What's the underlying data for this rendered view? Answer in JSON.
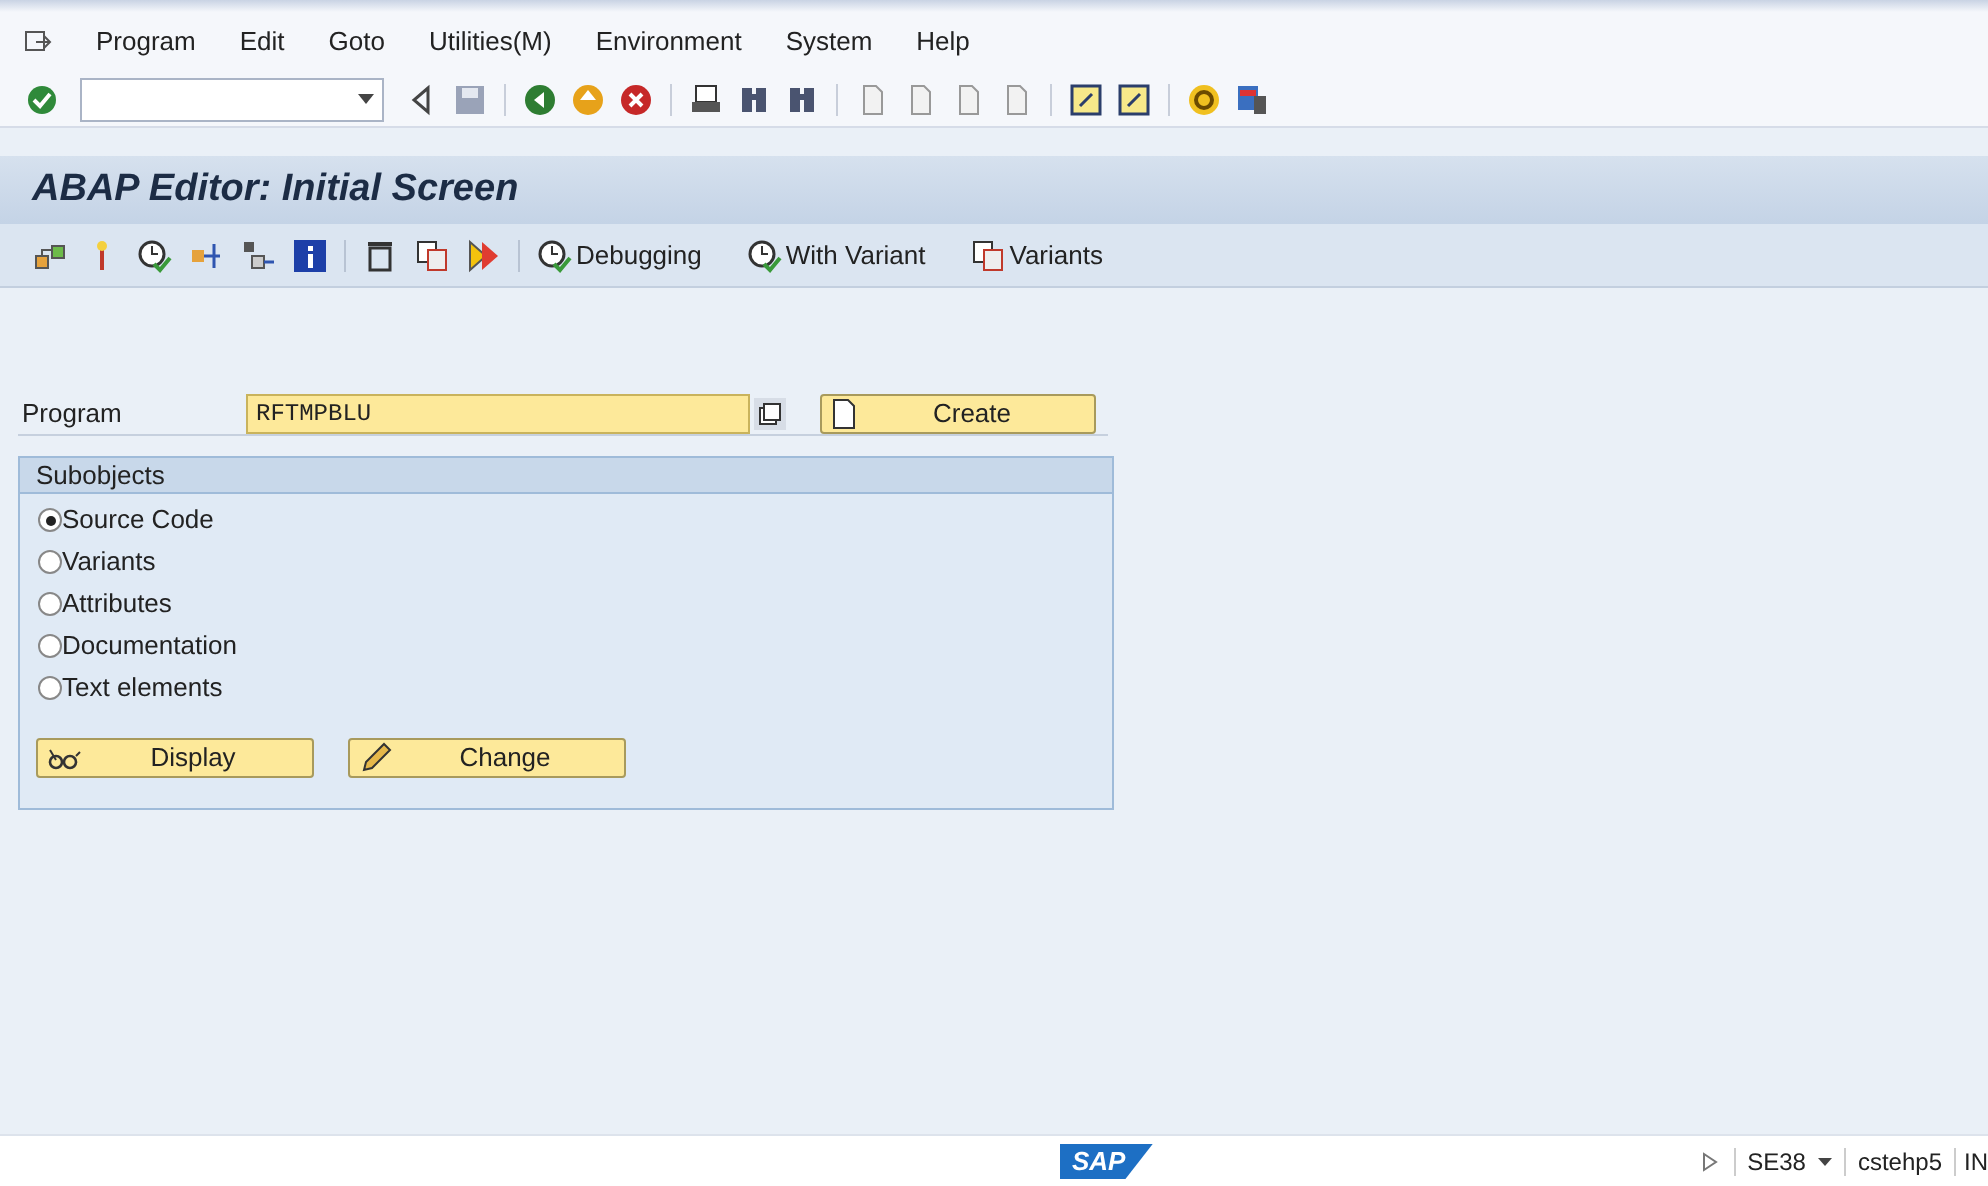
{
  "menu": [
    "Program",
    "Edit",
    "Goto",
    "Utilities(M)",
    "Environment",
    "System",
    "Help"
  ],
  "toolbar": [
    {
      "kind": "check"
    },
    {
      "kind": "field"
    },
    {
      "kind": "back"
    },
    {
      "kind": "save"
    },
    {
      "kind": "sep"
    },
    {
      "kind": "green"
    },
    {
      "kind": "orange"
    },
    {
      "kind": "red"
    },
    {
      "kind": "sep"
    },
    {
      "kind": "print"
    },
    {
      "kind": "find"
    },
    {
      "kind": "find"
    },
    {
      "kind": "sep"
    },
    {
      "kind": "page"
    },
    {
      "kind": "page"
    },
    {
      "kind": "page"
    },
    {
      "kind": "page"
    },
    {
      "kind": "sep"
    },
    {
      "kind": "window"
    },
    {
      "kind": "window"
    },
    {
      "kind": "sep"
    },
    {
      "kind": "help"
    },
    {
      "kind": "monitor"
    }
  ],
  "title": "ABAP Editor: Initial Screen",
  "app_toolbar": [
    {
      "kind": "icon"
    },
    {
      "kind": "icon"
    },
    {
      "kind": "icon"
    },
    {
      "kind": "icon"
    },
    {
      "kind": "icon"
    },
    {
      "kind": "icon"
    },
    {
      "kind": "sep"
    },
    {
      "kind": "icon"
    },
    {
      "kind": "icon"
    },
    {
      "kind": "icon"
    },
    {
      "kind": "sep"
    },
    {
      "kind": "text",
      "label": "Debugging"
    },
    {
      "kind": "text",
      "label": "With Variant"
    },
    {
      "kind": "text",
      "label": "Variants"
    }
  ],
  "program": {
    "label": "Program",
    "value": "RFTMPBLU",
    "button": "Create"
  },
  "subobjects": {
    "title": "Subobjects",
    "options": [
      {
        "label": "Source Code",
        "selected": true
      },
      {
        "label": "Variants",
        "selected": false
      },
      {
        "label": "Attributes",
        "selected": false
      },
      {
        "label": "Documentation",
        "selected": false
      },
      {
        "label": "Text elements",
        "selected": false
      }
    ],
    "buttons": [
      {
        "label": "Display"
      },
      {
        "label": "Change"
      }
    ]
  },
  "status_bar": {
    "logo_text": "SAP",
    "transaction": "SE38",
    "server": "cstehp5",
    "mode": "IN"
  }
}
